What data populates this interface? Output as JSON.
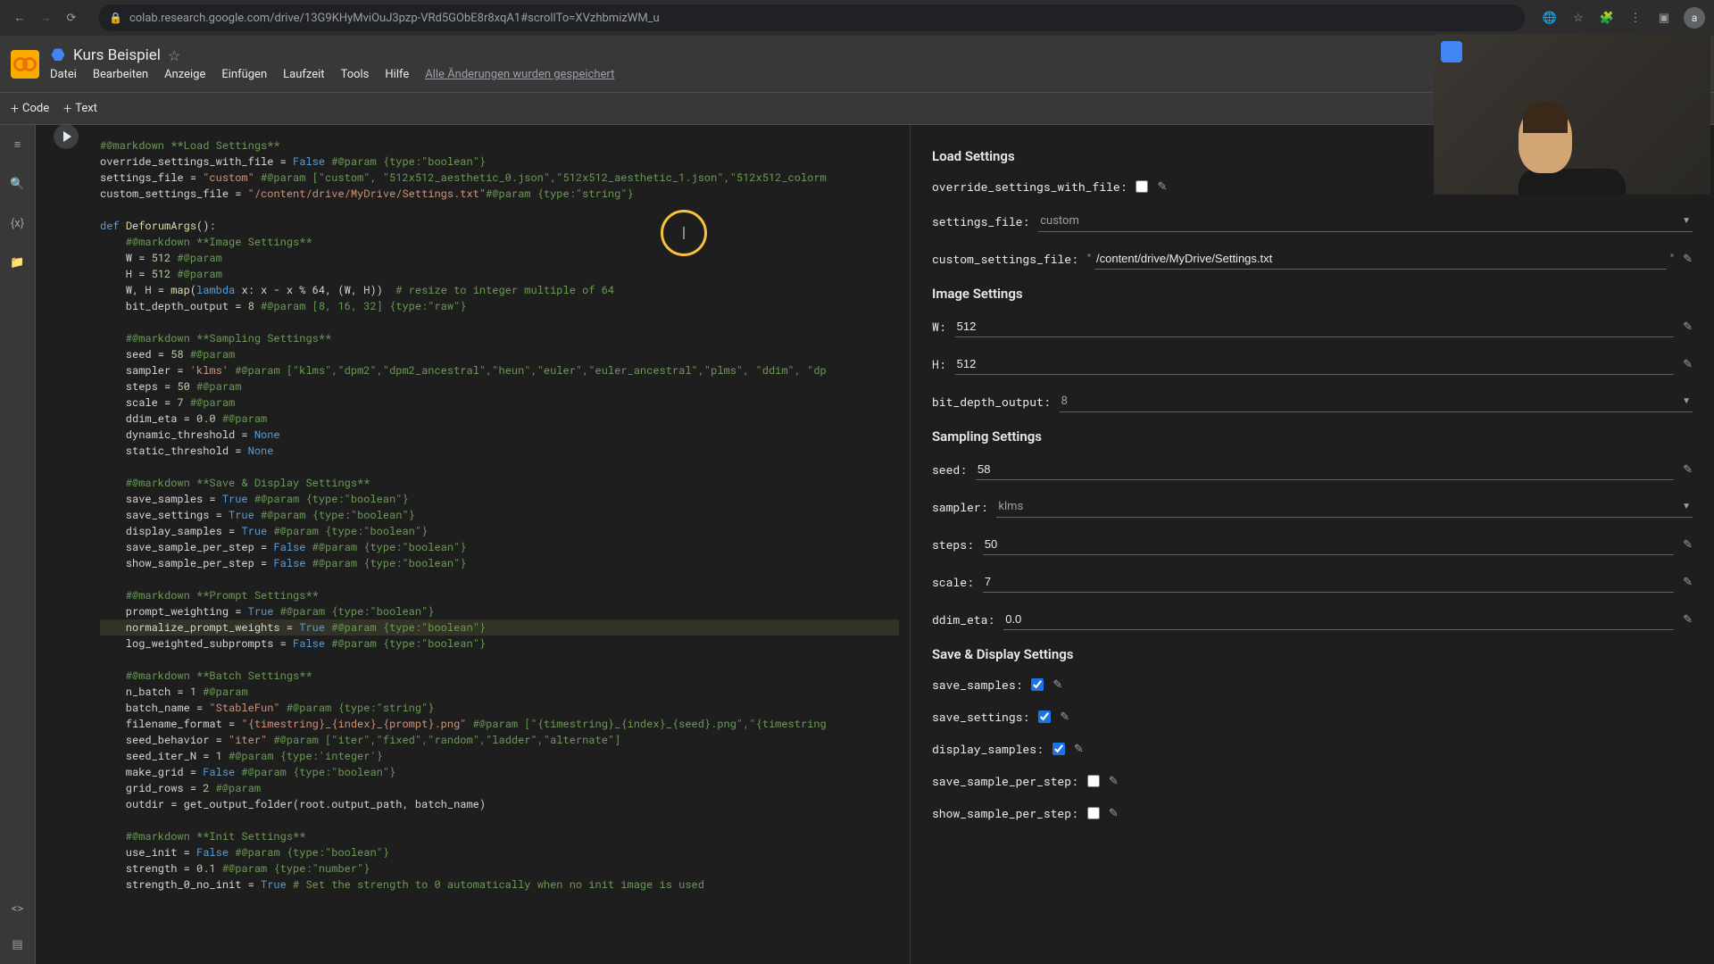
{
  "browser": {
    "url": "colab.research.google.com/drive/13G9KHyMviOuJ3pzp-VRd5GObE8r8xqA1#scrollTo=XVzhbmizWM_u"
  },
  "notebook": {
    "title": "Kurs Beispiel",
    "menus": [
      "Datei",
      "Bearbeiten",
      "Anzeige",
      "Einfügen",
      "Laufzeit",
      "Tools",
      "Hilfe"
    ],
    "save_status": "Alle Änderungen wurden gespeichert"
  },
  "toolbar": {
    "code_btn": "Code",
    "text_btn": "Text"
  },
  "cell_bracket": "[ ]",
  "code": {
    "l1": "#@markdown **Load Settings**",
    "l2a": "override_settings_with_file = ",
    "l2b": "False",
    "l2c": " #@param {type:\"boolean\"}",
    "l3a": "settings_file = ",
    "l3b": "\"custom\"",
    "l3c": " #@param [\"custom\", \"512x512_aesthetic_0.json\",\"512x512_aesthetic_1.json\",\"512x512_colorm",
    "l4a": "custom_settings_file = ",
    "l4b": "\"/content/drive/MyDrive/Settings.txt\"",
    "l4c": "#@param {type:\"string\"}",
    "l6a": "def ",
    "l6b": "DeforumArgs",
    "l6c": "():",
    "l7": "    #@markdown **Image Settings**",
    "l8a": "    W = ",
    "l8b": "512",
    "l8c": " #@param",
    "l9a": "    H = ",
    "l9b": "512",
    "l9c": " #@param",
    "l10a": "    W, H = ",
    "l10b": "map",
    "l10c": "(",
    "l10d": "lambda",
    "l10e": " x: x - x % 64, (W, H))  ",
    "l10f": "# resize to integer multiple of 64",
    "l11a": "    bit_depth_output = ",
    "l11b": "8",
    "l11c": " #@param [8, 16, 32] {type:\"raw\"}",
    "l13": "    #@markdown **Sampling Settings**",
    "l14a": "    seed = ",
    "l14b": "58",
    "l14c": " #@param",
    "l15a": "    sampler = ",
    "l15b": "'klms'",
    "l15c": " #@param [\"klms\",\"dpm2\",\"dpm2_ancestral\",\"heun\",\"euler\",\"euler_ancestral\",\"plms\", \"ddim\", \"dp",
    "l16a": "    steps = ",
    "l16b": "50",
    "l16c": " #@param",
    "l17a": "    scale = ",
    "l17b": "7",
    "l17c": " #@param",
    "l18a": "    ddim_eta = ",
    "l18b": "0.0",
    "l18c": " #@param",
    "l19a": "    dynamic_threshold = ",
    "l19b": "None",
    "l20a": "    static_threshold = ",
    "l20b": "None",
    "l22": "    #@markdown **Save & Display Settings**",
    "l23a": "    save_samples = ",
    "l23b": "True",
    "l23c": " #@param {type:\"boolean\"}",
    "l24a": "    save_settings = ",
    "l24b": "True",
    "l24c": " #@param {type:\"boolean\"}",
    "l25a": "    display_samples = ",
    "l25b": "True",
    "l25c": " #@param {type:\"boolean\"}",
    "l26a": "    save_sample_per_step = ",
    "l26b": "False",
    "l26c": " #@param {type:\"boolean\"}",
    "l27a": "    show_sample_per_step = ",
    "l27b": "False",
    "l27c": " #@param {type:\"boolean\"}",
    "l29": "    #@markdown **Prompt Settings**",
    "l30a": "    prompt_weighting = ",
    "l30b": "True",
    "l30c": " #@param {type:\"boolean\"}",
    "l31a": "    normalize_prompt_weights = ",
    "l31b": "True",
    "l31c": " #@param {type:\"boolean\"}",
    "l32a": "    log_weighted_subprompts = ",
    "l32b": "False",
    "l32c": " #@param {type:\"boolean\"}",
    "l34": "    #@markdown **Batch Settings**",
    "l35a": "    n_batch = ",
    "l35b": "1",
    "l35c": " #@param",
    "l36a": "    batch_name = ",
    "l36b": "\"StableFun\"",
    "l36c": " #@param {type:\"string\"}",
    "l37a": "    filename_format = ",
    "l37b": "\"{timestring}_{index}_{prompt}.png\"",
    "l37c": " #@param [\"{timestring}_{index}_{seed}.png\",\"{timestring",
    "l38a": "    seed_behavior = ",
    "l38b": "\"iter\"",
    "l38c": " #@param [\"iter\",\"fixed\",\"random\",\"ladder\",\"alternate\"]",
    "l39a": "    seed_iter_N = ",
    "l39b": "1",
    "l39c": " #@param {type:'integer'}",
    "l40a": "    make_grid = ",
    "l40b": "False",
    "l40c": " #@param {type:\"boolean\"}",
    "l41a": "    grid_rows = ",
    "l41b": "2",
    "l41c": " #@param",
    "l42": "    outdir = get_output_folder(root.output_path, batch_name)",
    "l44": "    #@markdown **Init Settings**",
    "l45a": "    use_init = ",
    "l45b": "False",
    "l45c": " #@param {type:\"boolean\"}",
    "l46a": "    strength = ",
    "l46b": "0.1",
    "l46c": " #@param {type:\"number\"}",
    "l47a": "    strength_0_no_init = ",
    "l47b": "True",
    "l47c": " # Set the strength to 0 automatically when no init image is used"
  },
  "form": {
    "load_settings_title": "Load Settings",
    "override_label": "override_settings_with_file:",
    "settings_file_label": "settings_file:",
    "settings_file_value": "custom",
    "custom_settings_label": "custom_settings_file:",
    "custom_settings_value": "/content/drive/MyDrive/Settings.txt",
    "image_settings_title": "Image Settings",
    "w_label": "W:",
    "w_value": "512",
    "h_label": "H:",
    "h_value": "512",
    "bit_depth_label": "bit_depth_output:",
    "bit_depth_value": "8",
    "sampling_title": "Sampling Settings",
    "seed_label": "seed:",
    "seed_value": "58",
    "sampler_label": "sampler:",
    "sampler_value": "klms",
    "steps_label": "steps:",
    "steps_value": "50",
    "scale_label": "scale:",
    "scale_value": "7",
    "ddim_eta_label": "ddim_eta:",
    "ddim_eta_value": "0.0",
    "save_display_title": "Save & Display Settings",
    "save_samples_label": "save_samples:",
    "save_settings_label": "save_settings:",
    "display_samples_label": "display_samples:",
    "save_per_step_label": "save_sample_per_step:",
    "show_per_step_label": "show_sample_per_step:"
  }
}
